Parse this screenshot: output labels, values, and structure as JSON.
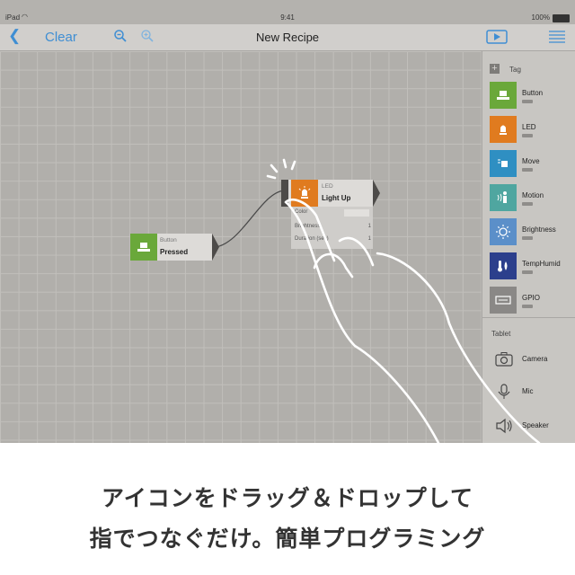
{
  "status_bar": {
    "carrier": "iPad",
    "time": "9:41",
    "battery": "100%"
  },
  "nav": {
    "back_icon": "chevron-left-icon",
    "clear_label": "Clear",
    "title": "New Recipe"
  },
  "palette": {
    "tag_section": "Tag",
    "tag_items": [
      {
        "label": "Button",
        "color": "#6aa83a",
        "icon": "button-icon"
      },
      {
        "label": "LED",
        "color": "#e07b1f",
        "icon": "led-icon"
      },
      {
        "label": "Move",
        "color": "#2f8fc2",
        "icon": "move-icon"
      },
      {
        "label": "Motion",
        "color": "#4fa6a0",
        "icon": "motion-icon"
      },
      {
        "label": "Brightness",
        "color": "#5b8fc9",
        "icon": "brightness-icon"
      },
      {
        "label": "TempHumid",
        "color": "#2c3f8c",
        "icon": "temphumid-icon"
      },
      {
        "label": "GPIO",
        "color": "#8a8886",
        "icon": "gpio-icon"
      }
    ],
    "tablet_section": "Tablet",
    "tablet_items": [
      {
        "label": "Camera",
        "icon": "camera-icon"
      },
      {
        "label": "Mic",
        "icon": "mic-icon"
      },
      {
        "label": "Speaker",
        "icon": "speaker-icon"
      }
    ]
  },
  "canvas": {
    "button_block": {
      "type": "Button",
      "name": "Pressed",
      "color": "#6aa83a"
    },
    "led_block": {
      "type": "LED",
      "name": "Light Up",
      "color": "#e07b1f",
      "props": [
        {
          "label": "Color",
          "value": ""
        },
        {
          "label": "Brightness",
          "value": "1"
        },
        {
          "label": "Duration (sec)",
          "value": "1"
        }
      ]
    }
  },
  "caption": {
    "line1": "アイコンをドラッグ＆ドロップして",
    "line2": "指でつなぐだけ。簡単プログラミング"
  }
}
